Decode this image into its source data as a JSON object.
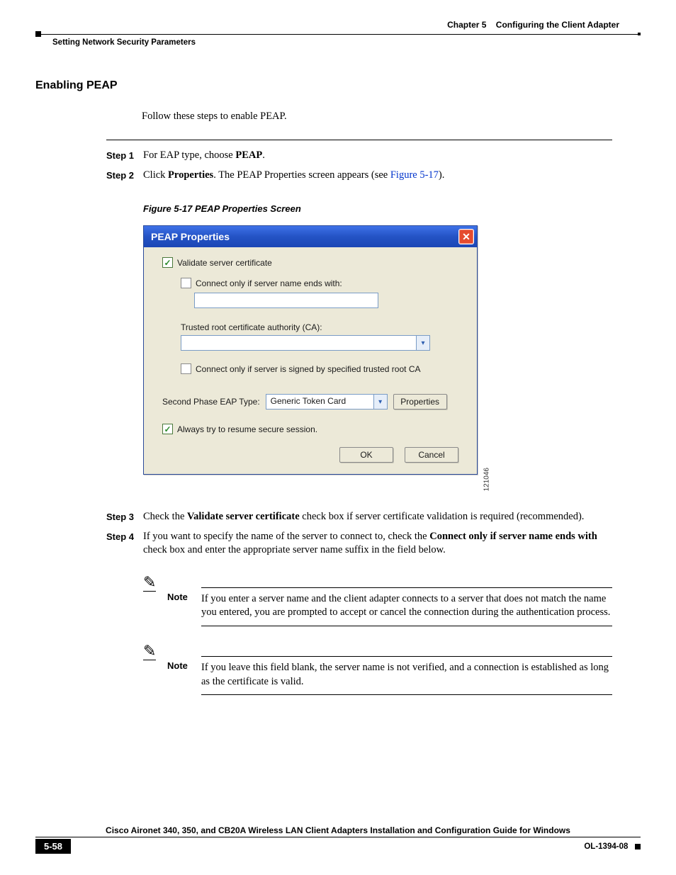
{
  "header": {
    "chapter_label": "Chapter 5",
    "chapter_title": "Configuring the Client Adapter",
    "section_path": "Setting Network Security Parameters"
  },
  "section": {
    "title": "Enabling PEAP",
    "intro": "Follow these steps to enable PEAP."
  },
  "steps": {
    "s1_label": "Step 1",
    "s1_a": "For EAP type, choose ",
    "s1_b_bold": "PEAP",
    "s1_c": ".",
    "s2_label": "Step 2",
    "s2_a": "Click ",
    "s2_b_bold": "Properties",
    "s2_c": ". The PEAP Properties screen appears (see ",
    "s2_link": "Figure 5-17",
    "s2_d": ").",
    "s3_label": "Step 3",
    "s3_a": "Check the ",
    "s3_b_bold": "Validate server certificate",
    "s3_c": " check box if server certificate validation is required (recommended).",
    "s4_label": "Step 4",
    "s4_a": "If you want to specify the name of the server to connect to, check the ",
    "s4_b_bold": "Connect only if server name ends with",
    "s4_c": " check box and enter the appropriate server name suffix in the field below."
  },
  "figure": {
    "caption": "Figure 5-17   PEAP Properties Screen",
    "image_number": "121046"
  },
  "dialog": {
    "title": "PEAP Properties",
    "close_glyph": "✕",
    "validate_label": "Validate server certificate",
    "connect_only_name_label": "Connect only if server name ends with:",
    "trusted_ca_label": "Trusted root certificate authority (CA):",
    "connect_only_signed_label": "Connect only if server is signed by specified trusted root CA",
    "second_phase_label": "Second Phase EAP Type:",
    "second_phase_value": "Generic Token Card",
    "properties_btn": "Properties",
    "resume_label": "Always try to resume secure session.",
    "ok_btn": "OK",
    "cancel_btn": "Cancel",
    "arrow_glyph": "▾"
  },
  "notes": {
    "pen_glyph": "✎",
    "label": "Note",
    "n1": "If you enter a server name and the client adapter connects to a server that does not match the name you entered, you are prompted to accept or cancel the connection during the authentication process.",
    "n2": "If you leave this field blank, the server name is not verified, and a connection is established as long as the certificate is valid."
  },
  "footer": {
    "guide_title": "Cisco Aironet 340, 350, and CB20A Wireless LAN Client Adapters Installation and Configuration Guide for Windows",
    "page_number": "5-58",
    "doc_id": "OL-1394-08"
  }
}
